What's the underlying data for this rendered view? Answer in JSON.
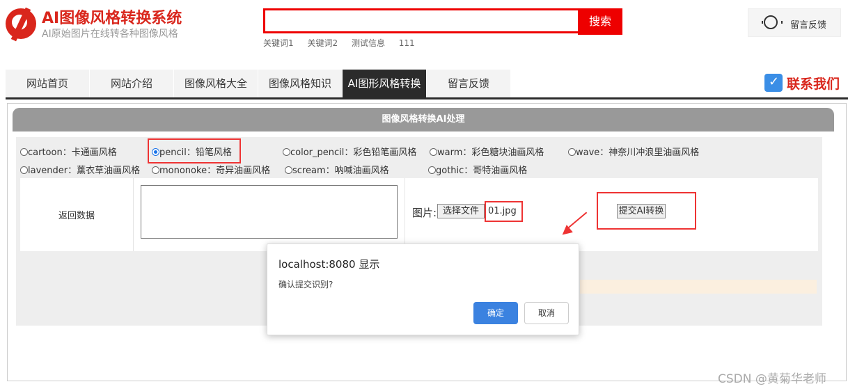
{
  "header": {
    "title": "AI图像风格转换系统",
    "subtitle": "AI原始图片在线转各种图像风格",
    "search_button": "搜索",
    "search_value": "",
    "keywords": [
      "关键词1",
      "关键词2",
      "测试信息",
      "111"
    ],
    "feedback_label": "留言反馈"
  },
  "nav": {
    "items": [
      "网站首页",
      "网站介绍",
      "图像风格大全",
      "图像风格知识",
      "AI图形风格转换",
      "留言反馈"
    ],
    "active_index": 4,
    "contact": "联系我们"
  },
  "panel": {
    "title": "图像风格转换AI处理",
    "styles": [
      {
        "label": "cartoon：卡通画风格",
        "selected": false
      },
      {
        "label": "pencil：铅笔风格",
        "selected": true
      },
      {
        "label": "color_pencil：彩色铅笔画风格",
        "selected": false
      },
      {
        "label": "warm：彩色糖块油画风格",
        "selected": false
      },
      {
        "label": "wave：神奈川冲浪里油画风格",
        "selected": false
      },
      {
        "label": "lavender：薰衣草油画风格",
        "selected": false
      },
      {
        "label": "mononoke：奇异油画风格",
        "selected": false
      },
      {
        "label": "scream：呐喊油画风格",
        "selected": false
      },
      {
        "label": "gothic：哥特油画风格",
        "selected": false
      }
    ],
    "return_label": "返回数据",
    "image_label": "图片:",
    "file_button": "选择文件",
    "file_name": "01.jpg",
    "submit_button": "提交AI转换"
  },
  "dialog": {
    "title": "localhost:8080 显示",
    "message": "确认提交识别?",
    "ok": "确定",
    "cancel": "取消"
  },
  "watermark": "CSDN @黄菊华老师",
  "colors": {
    "brand_red": "#d9261c",
    "nav_active": "#2b2b2b",
    "dialog_ok": "#3b82e0"
  }
}
